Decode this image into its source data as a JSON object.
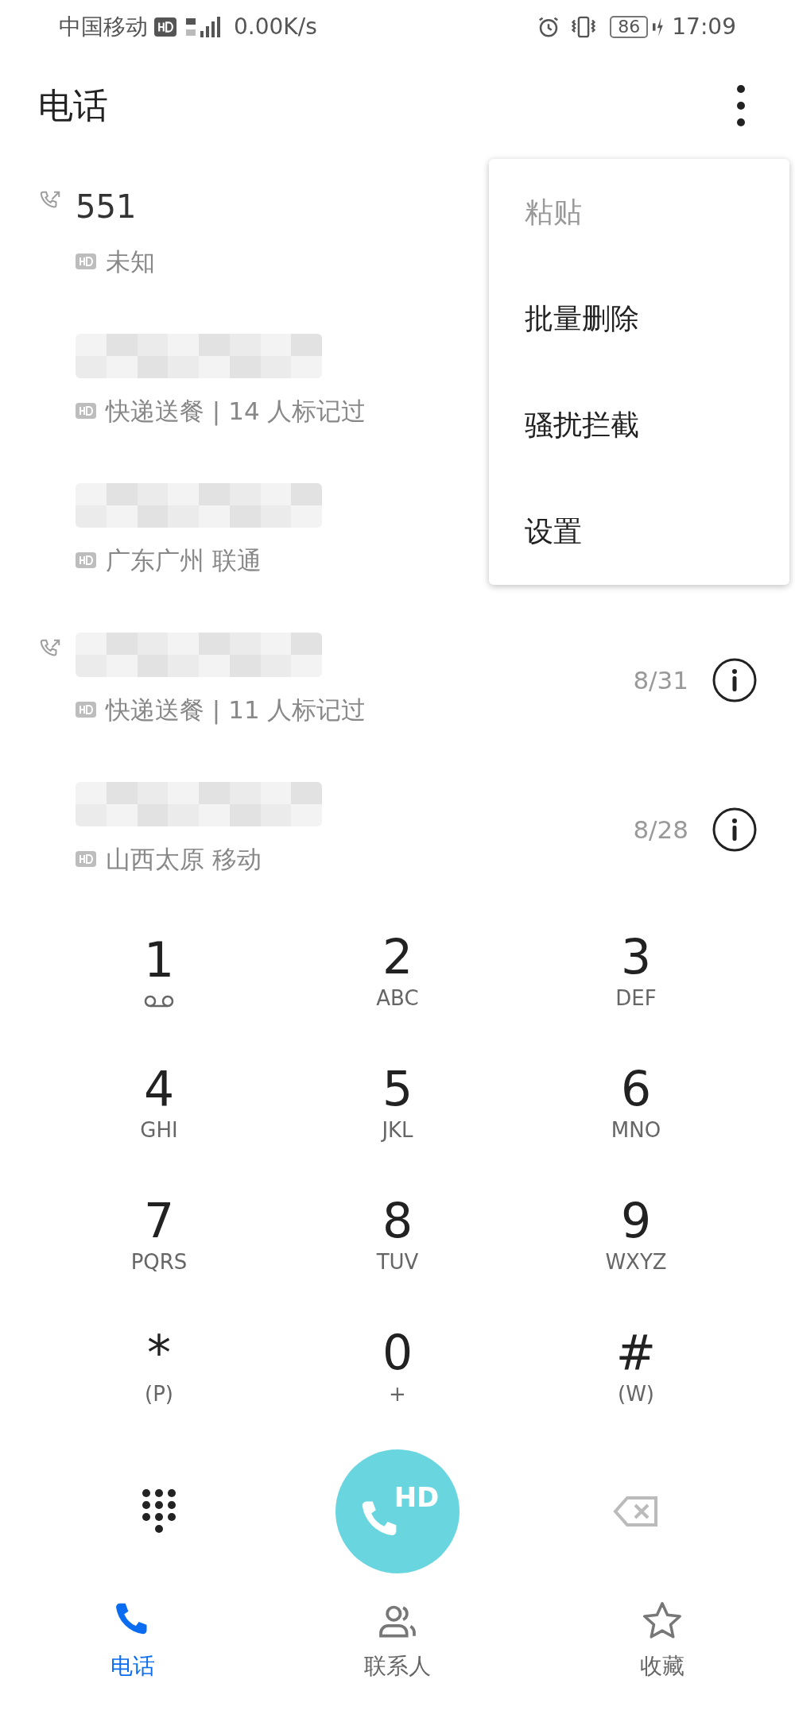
{
  "status_bar": {
    "carrier": "中国移动",
    "speed": "0.00K/s",
    "battery": "86",
    "time": "17:09"
  },
  "title": "电话",
  "calls": [
    {
      "name": "551",
      "name_blurred": false,
      "outgoing": true,
      "detail": "未知"
    },
    {
      "name_blurred": true,
      "outgoing": false,
      "detail": "快递送餐 | 14 人标记过"
    },
    {
      "name_blurred": true,
      "outgoing": false,
      "detail": "广东广州 联通"
    },
    {
      "name_blurred": true,
      "outgoing": true,
      "detail": "快递送餐 | 11 人标记过",
      "date": "8/31"
    },
    {
      "name_blurred": true,
      "outgoing": false,
      "detail": "山西太原 移动",
      "date": "8/28"
    }
  ],
  "menu": [
    {
      "label": "粘贴",
      "disabled": true
    },
    {
      "label": "批量删除",
      "disabled": false
    },
    {
      "label": "骚扰拦截",
      "disabled": false
    },
    {
      "label": "设置",
      "disabled": false
    }
  ],
  "keys": [
    {
      "digit": "1",
      "kind": "voicemail"
    },
    {
      "digit": "2",
      "kind": "letters",
      "sub": "ABC"
    },
    {
      "digit": "3",
      "kind": "letters",
      "sub": "DEF"
    },
    {
      "digit": "4",
      "kind": "letters",
      "sub": "GHI"
    },
    {
      "digit": "5",
      "kind": "letters",
      "sub": "JKL"
    },
    {
      "digit": "6",
      "kind": "letters",
      "sub": "MNO"
    },
    {
      "digit": "7",
      "kind": "letters",
      "sub": "PQRS"
    },
    {
      "digit": "8",
      "kind": "letters",
      "sub": "TUV"
    },
    {
      "digit": "9",
      "kind": "letters",
      "sub": "WXYZ"
    },
    {
      "digit": "*",
      "kind": "letters",
      "sub": "(P)"
    },
    {
      "digit": "0",
      "kind": "letters",
      "sub": "+"
    },
    {
      "digit": "#",
      "kind": "letters",
      "sub": "(W)"
    }
  ],
  "call_button": {
    "badge": "HD"
  },
  "nav": [
    {
      "label": "电话",
      "kind": "phone",
      "selected": true
    },
    {
      "label": "联系人",
      "kind": "contacts",
      "selected": false
    },
    {
      "label": "收藏",
      "kind": "favorites",
      "selected": false
    }
  ]
}
